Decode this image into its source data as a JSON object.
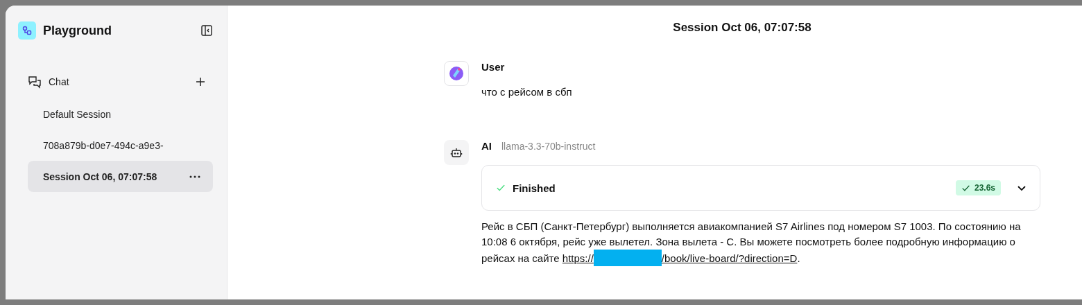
{
  "sidebar": {
    "app_title": "Playground",
    "section": {
      "label": "Chat"
    },
    "sessions": [
      {
        "label": "Default Session",
        "selected": false
      },
      {
        "label": "708a879b-d0e7-494c-a9e3-",
        "selected": false
      },
      {
        "label": "Session Oct 06, 07:07:58",
        "selected": true
      }
    ]
  },
  "main": {
    "title": "Session Oct 06, 07:07:58",
    "messages": [
      {
        "kind": "user",
        "author": "User",
        "text": "что с рейсом в сбп"
      },
      {
        "kind": "ai",
        "author": "AI",
        "model": "llama-3.3-70b-instruct",
        "status": {
          "label": "Finished",
          "duration": "23.6s",
          "expanded": false
        },
        "text": "Рейс в СБП (Санкт-Петербург) выполняется авиакомпанией S7 Airlines под номером S7 1003. По состоянию на 10:08 6 октября, рейс уже вылетел. Зона вылета - С. Вы можете посмотреть более подробную информацию о рейсах на сайте ",
        "link": {
          "prefix": "https://",
          "suffix": "/book/live-board/?direction=D"
        },
        "text_after": "."
      }
    ]
  }
}
